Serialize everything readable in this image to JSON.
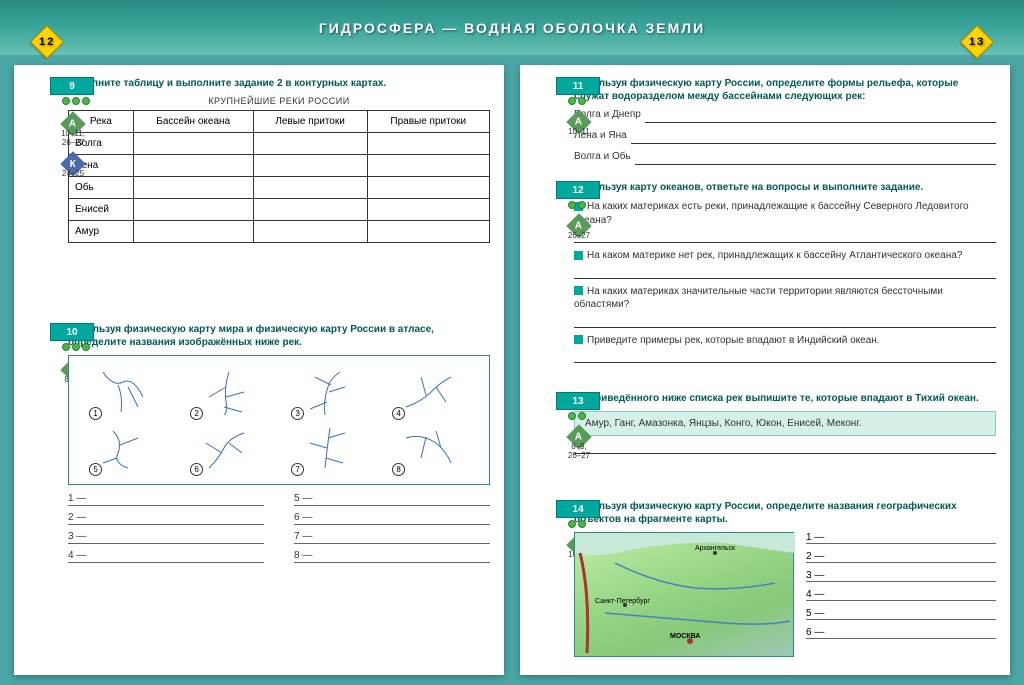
{
  "header": {
    "title": "ГИДРОСФЕРА — ВОДНАЯ     ОБОЛОЧКА ЗЕМЛИ",
    "page_left": "12",
    "page_right": "13"
  },
  "left": {
    "task9": {
      "num": "9",
      "text": "Заполните таблицу и выполните задание 2 в контурных картах.",
      "subtitle": "КРУПНЕЙШИЕ РЕКИ РОССИИ",
      "refs": {
        "atlas": "10–11, 26–27",
        "kontur": "24–25"
      },
      "headers": [
        "Река",
        "Бассейн океана",
        "Левые притоки",
        "Правые притоки"
      ],
      "rows": [
        "Волга",
        "Лена",
        "Обь",
        "Енисей",
        "Амур"
      ]
    },
    "task10": {
      "num": "10",
      "text": "Используя физическую карту мира и физическую карту России в атласе, определите названия изображённых ниже рек.",
      "refs": {
        "atlas": "8–11"
      },
      "labels": [
        "1",
        "2",
        "3",
        "4",
        "5",
        "6",
        "7",
        "8"
      ],
      "answers": [
        "1 —",
        "2 —",
        "3 —",
        "4 —",
        "5 —",
        "6 —",
        "7 —",
        "8 —"
      ]
    }
  },
  "right": {
    "task11": {
      "num": "11",
      "text": "Используя физическую карту России, определите формы рельефа, которые служат водоразделом между бассейнами следующих рек:",
      "refs": {
        "atlas": "10–11"
      },
      "lines": [
        "Волга и Днепр",
        "Лена и Яна",
        "Волга и Обь"
      ]
    },
    "task12": {
      "num": "12",
      "text": "Используя карту океанов, ответьте на вопросы и выполните задание.",
      "refs": {
        "atlas": "26–27"
      },
      "q1": "На каких материках есть реки, принадлежащие к бассейну Северного Ледовитого океана?",
      "q2": "На каком материке нет рек, принадлежащих к бассейну Атлантического океана?",
      "q3": "На каких материках значительные части территории являются бессточными областями?",
      "q4": "Приведите примеры рек, которые впадают в Индийский океан."
    },
    "task13": {
      "num": "13",
      "text": "Из приведённого ниже списка рек выпишите те, которые впадают в Тихий океан.",
      "refs": {
        "atlas": "8–9, 26–27"
      },
      "list": "Амур, Ганг, Амазонка, Янцзы, Конго, Юкон, Енисей, Меконг."
    },
    "task14": {
      "num": "14",
      "text": "Используя физическую карту России, определите названия географических объектов на фрагменте карты.",
      "refs": {
        "atlas": "10–11"
      },
      "cities": {
        "arh": "Архангельск",
        "spb": "Санкт-Петербург",
        "msk": "МОСКВА"
      },
      "answers": [
        "1 —",
        "2 —",
        "3 —",
        "4 —",
        "5 —",
        "6 —"
      ]
    }
  }
}
